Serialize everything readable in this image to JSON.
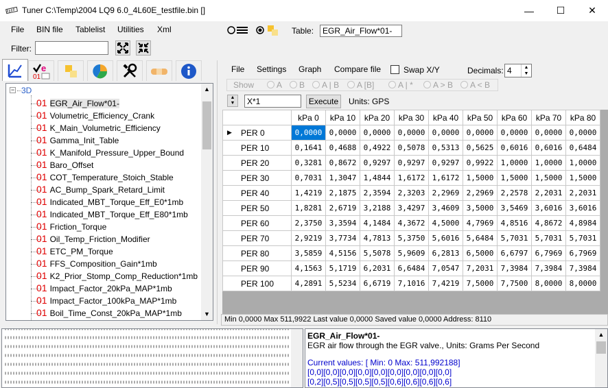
{
  "window": {
    "title": "Tuner C:\\Temp\\2004 LQ9 6.0_4L60E_testfile.bin []",
    "min_glyph": "—",
    "max_glyph": "☐",
    "close_glyph": "✕"
  },
  "menubar": {
    "items": [
      "File",
      "BIN file",
      "Tablelist",
      "Utilities",
      "Xml"
    ],
    "table_label": "Table:",
    "table_value": "EGR_Air_Flow*01-"
  },
  "filter": {
    "label": "Filter:",
    "value": ""
  },
  "tree": {
    "root": "3D",
    "items": [
      {
        "num": "01",
        "label": "EGR_Air_Flow*01-"
      },
      {
        "num": "01",
        "label": "Volumetric_Efficiency_Crank"
      },
      {
        "num": "01",
        "label": "K_Main_Volumetric_Efficiency"
      },
      {
        "num": "01",
        "label": "Gamma_Init_Table"
      },
      {
        "num": "01",
        "label": "K_Manifold_Pressure_Upper_Bound"
      },
      {
        "num": "01",
        "label": "Baro_Offset"
      },
      {
        "num": "01",
        "label": "COT_Temperature_Stoich_Stable"
      },
      {
        "num": "01",
        "label": "AC_Bump_Spark_Retard_Limit"
      },
      {
        "num": "01",
        "label": "Indicated_MBT_Torque_Eff_E0*1mb"
      },
      {
        "num": "01",
        "label": "Indicated_MBT_Torque_Eff_E80*1mb"
      },
      {
        "num": "01",
        "label": "Friction_Torque"
      },
      {
        "num": "01",
        "label": "Oil_Temp_Friction_Modifier"
      },
      {
        "num": "01",
        "label": "ETC_PM_Torque"
      },
      {
        "num": "01",
        "label": "FFS_Composition_Gain*1mb"
      },
      {
        "num": "01",
        "label": "K2_Prior_Stomp_Comp_Reduction*1mb"
      },
      {
        "num": "01",
        "label": "Impact_Factor_20kPa_MAP*1mb"
      },
      {
        "num": "01",
        "label": "Impact_Factor_100kPa_MAP*1mb"
      },
      {
        "num": "01",
        "label": "Boil_Time_Const_20kPa_MAP*1mb"
      }
    ]
  },
  "tabs": [
    "axes-icon",
    "checkmark-e-icon",
    "squares-icon",
    "pie-chart-icon",
    "tools-icon",
    "bandage-icon",
    "info-icon"
  ],
  "editor_menu": {
    "items": [
      "File",
      "Settings",
      "Graph",
      "Compare file"
    ],
    "swap_label": "Swap X/Y",
    "decimals_label": "Decimals:",
    "decimals_value": "4"
  },
  "show_bar": {
    "label": "Show",
    "options": [
      "A",
      "B",
      "A | B",
      "A [B]",
      "A | *",
      "A > B",
      "A < B"
    ]
  },
  "math": {
    "expression": "X*1",
    "execute_label": "Execute",
    "units": "Units: GPS"
  },
  "grid": {
    "columns": [
      "kPa  0",
      "kPa 10",
      "kPa 20",
      "kPa 30",
      "kPa 40",
      "kPa 50",
      "kPa 60",
      "kPa 70",
      "kPa 80"
    ],
    "rows": [
      {
        "label": "PER  0",
        "values": [
          "0,0000",
          "0,0000",
          "0,0000",
          "0,0000",
          "0,0000",
          "0,0000",
          "0,0000",
          "0,0000",
          "0,0000"
        ]
      },
      {
        "label": "PER  10",
        "values": [
          "0,1641",
          "0,4688",
          "0,4922",
          "0,5078",
          "0,5313",
          "0,5625",
          "0,6016",
          "0,6016",
          "0,6484"
        ]
      },
      {
        "label": "PER  20",
        "values": [
          "0,3281",
          "0,8672",
          "0,9297",
          "0,9297",
          "0,9297",
          "0,9922",
          "1,0000",
          "1,0000",
          "1,0000"
        ]
      },
      {
        "label": "PER  30",
        "values": [
          "0,7031",
          "1,3047",
          "1,4844",
          "1,6172",
          "1,6172",
          "1,5000",
          "1,5000",
          "1,5000",
          "1,5000"
        ]
      },
      {
        "label": "PER  40",
        "values": [
          "1,4219",
          "2,1875",
          "2,3594",
          "2,3203",
          "2,2969",
          "2,2969",
          "2,2578",
          "2,2031",
          "2,2031"
        ]
      },
      {
        "label": "PER  50",
        "values": [
          "1,8281",
          "2,6719",
          "3,2188",
          "3,4297",
          "3,4609",
          "3,5000",
          "3,5469",
          "3,6016",
          "3,6016"
        ]
      },
      {
        "label": "PER  60",
        "values": [
          "2,3750",
          "3,3594",
          "4,1484",
          "4,3672",
          "4,5000",
          "4,7969",
          "4,8516",
          "4,8672",
          "4,8984"
        ]
      },
      {
        "label": "PER  70",
        "values": [
          "2,9219",
          "3,7734",
          "4,7813",
          "5,3750",
          "5,6016",
          "5,6484",
          "5,7031",
          "5,7031",
          "5,7031"
        ]
      },
      {
        "label": "PER  80",
        "values": [
          "3,5859",
          "4,5156",
          "5,5078",
          "5,9609",
          "6,2813",
          "6,5000",
          "6,6797",
          "6,7969",
          "6,7969"
        ]
      },
      {
        "label": "PER  90",
        "values": [
          "4,1563",
          "5,1719",
          "6,2031",
          "6,6484",
          "7,0547",
          "7,2031",
          "7,3984",
          "7,3984",
          "7,3984"
        ]
      },
      {
        "label": "PER 100",
        "values": [
          "4,2891",
          "5,5234",
          "6,6719",
          "7,1016",
          "7,4219",
          "7,5000",
          "7,7500",
          "8,0000",
          "8,0000"
        ]
      }
    ]
  },
  "statusbar": "Min 0,0000 Max 511,9922 Last value 0,0000 Saved value 0,0000 Address: 8110",
  "info": {
    "title": "EGR_Air_Flow*01-",
    "description": "EGR air flow through the EGR valve., Units: Grams Per Second",
    "current_values": "Current values:  [ Min: 0 Max: 511,992188]",
    "line1": "[0,0][0,0][0,0][0,0][0,0][0,0][0,0][0,0][0,0]",
    "line2": "[0,2][0,5][0,5][0,5][0,5][0,6][0,6][0,6][0,6]"
  },
  "colors": {
    "selection": "#0078d7",
    "tree_number": "#e00000",
    "info_link": "#0000cc"
  }
}
